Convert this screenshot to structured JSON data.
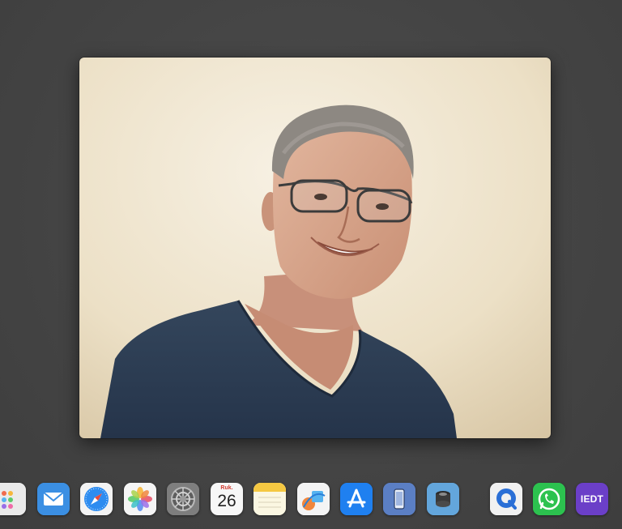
{
  "photo": {
    "subject": "portrait-photo",
    "colors": {
      "background_light": "#f3ecdc",
      "background_dark": "#d9c9a8",
      "shirt": "#2e3e52"
    }
  },
  "dock": {
    "calendar": {
      "month": "Ruk.",
      "day": "26"
    },
    "iedt_label": "IEDT",
    "icons": [
      {
        "name": "launchpad-icon"
      },
      {
        "name": "mail-icon"
      },
      {
        "name": "safari-icon"
      },
      {
        "name": "photos-icon"
      },
      {
        "name": "system-settings-icon"
      },
      {
        "name": "calendar-icon"
      },
      {
        "name": "notes-icon"
      },
      {
        "name": "freeform-icon"
      },
      {
        "name": "app-store-icon"
      },
      {
        "name": "iphone-mirroring-icon"
      },
      {
        "name": "disk-utility-icon"
      },
      {
        "name": "quicktime-icon"
      },
      {
        "name": "whatsapp-icon"
      },
      {
        "name": "iedt-app-icon"
      }
    ]
  },
  "colors": {
    "desktop": "#444444",
    "mail": "#3d8fe0",
    "app_store": "#1e7ff0",
    "whatsapp": "#2cc24f",
    "iedt": "#6b3fc8"
  }
}
